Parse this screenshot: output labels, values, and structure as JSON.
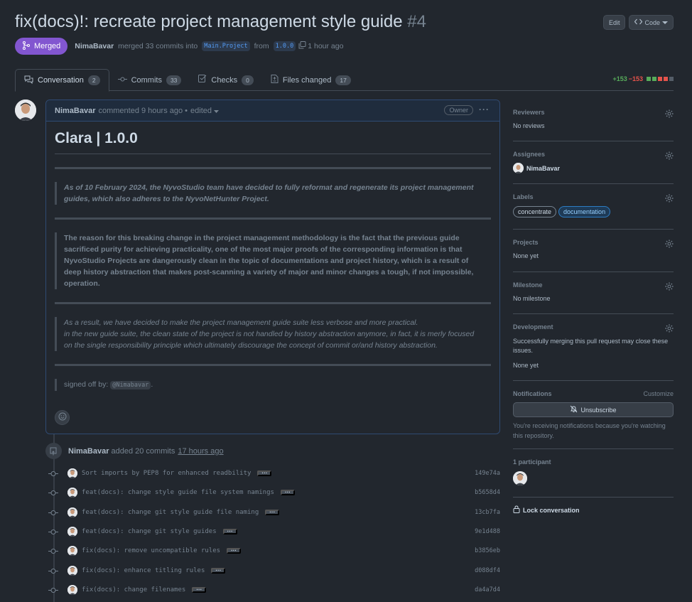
{
  "header": {
    "title": "fix(docs)!: recreate project management style guide",
    "number": "#4",
    "edit_label": "Edit",
    "code_label": "Code"
  },
  "meta": {
    "state": "Merged",
    "author": "NimaBavar",
    "action": "merged 33 commits into",
    "base_branch": "Main.Project",
    "from": "from",
    "head_branch": "1.0.0",
    "time": "1 hour ago"
  },
  "tabs": [
    {
      "label": "Conversation",
      "count": "2"
    },
    {
      "label": "Commits",
      "count": "33"
    },
    {
      "label": "Checks",
      "count": "0"
    },
    {
      "label": "Files changed",
      "count": "17"
    }
  ],
  "diffstat": {
    "additions": "+153",
    "deletions": "−153",
    "colors": {
      "add": "#57ab5a",
      "del": "#e5534b",
      "neutral": "#545d68"
    }
  },
  "comment": {
    "author": "NimaBavar",
    "action": "commented 9 hours ago •",
    "edited": "edited",
    "role": "Owner",
    "heading": "Clara | 1.0.0",
    "quote1": "As of 10 February 2024, the NyvoStudio team have decided to fully reformat and regenerate its project management guides, which also adheres to the NyvoNetHunter Project.",
    "quote2": "The reason for this breaking change in the project management methodology is the fact that the previous guide sacrificed purity for achieving practicality, one of the most major proofs of the corresponding information is that NyvoStudio Projects are dangerously clean in the topic of documentations and project history, which is a result of deep history abstraction that makes post-scanning a variety of major and minor changes a tough, if not impossible, operation.",
    "quote3_line1": "As a result, we have decided to make the project management guide suite less verbose and more practical.",
    "quote3_line2": "in the new guide suite, the clean state of the project is not handled by history abstraction anymore, in fact, it is merly focused on the single responsibility principle which ultimately discourage the concept of commit or/and history abstraction.",
    "signoff": "signed off by:",
    "mention": "@Nimabavar",
    "period": "."
  },
  "commit_event": {
    "author": "NimaBavar",
    "text": "added 20 commits",
    "time": "17 hours ago"
  },
  "commits": [
    {
      "message": "Sort imports by PEP8 for enhanced readbility",
      "sha": "149e74a"
    },
    {
      "message": "feat(docs): change style guide file system namings",
      "sha": "b5658d4"
    },
    {
      "message": "feat(docs): change git style guide file naming",
      "sha": "13cb7fa"
    },
    {
      "message": "feat(docs): change git style guides",
      "sha": "9e1d488"
    },
    {
      "message": "fix(docs): remove uncompatible rules",
      "sha": "b3856eb"
    },
    {
      "message": "fix(docs): enhance titling rules",
      "sha": "d088df4"
    },
    {
      "message": "fix(docs): change filenames",
      "sha": "da4a7d4"
    }
  ],
  "sidebar": {
    "reviewers": {
      "title": "Reviewers",
      "value": "No reviews"
    },
    "assignees": {
      "title": "Assignees",
      "value": "NimaBavar"
    },
    "labels": {
      "title": "Labels",
      "items": [
        "concentrate",
        "documentation"
      ]
    },
    "projects": {
      "title": "Projects",
      "value": "None yet"
    },
    "milestone": {
      "title": "Milestone",
      "value": "No milestone"
    },
    "development": {
      "title": "Development",
      "desc": "Successfully merging this pull request may close these issues.",
      "value": "None yet"
    },
    "notifications": {
      "title": "Notifications",
      "customize": "Customize",
      "button": "Unsubscribe",
      "desc": "You're receiving notifications because you're watching this repository."
    },
    "participants": {
      "title": "1 participant"
    },
    "lock": "Lock conversation"
  }
}
